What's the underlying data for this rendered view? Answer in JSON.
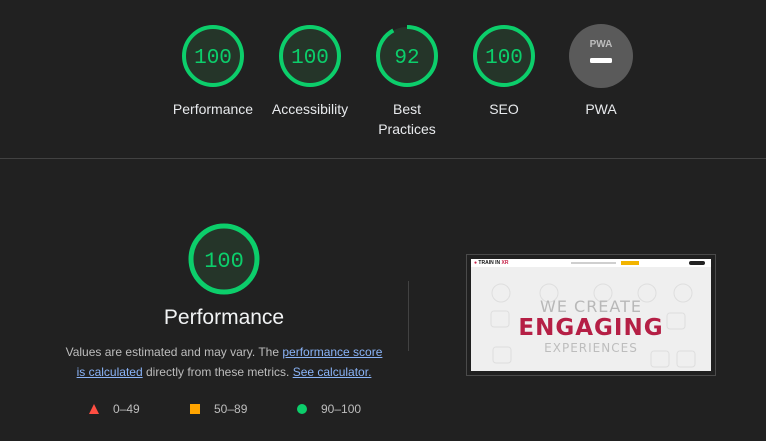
{
  "summary": {
    "categories": [
      {
        "label": "Performance",
        "score": "100",
        "value": 100
      },
      {
        "label": "Accessibility",
        "score": "100",
        "value": 100
      },
      {
        "label": "Best Practices",
        "score": "92",
        "value": 92
      },
      {
        "label": "SEO",
        "score": "100",
        "value": 100
      },
      {
        "label": "PWA",
        "score": "",
        "value": null,
        "badge_text": "PWA"
      }
    ]
  },
  "performance": {
    "score": "100",
    "value": 100,
    "title": "Performance",
    "desc_prefix": "Values are estimated and may vary. The ",
    "link1_part1": "performance score",
    "link1_part2": "is calculated",
    "desc_middle": " directly from these metrics. ",
    "link2": "See calculator."
  },
  "legend": [
    {
      "range": "0–49",
      "color": "#ff4e42",
      "shape": "triangle"
    },
    {
      "range": "50–89",
      "color": "#ffa400",
      "shape": "square"
    },
    {
      "range": "90–100",
      "color": "#0cce6b",
      "shape": "circle"
    }
  ],
  "screenshot": {
    "logo_prefix": "TRAIN IN ",
    "logo_xr": "XR",
    "line1": "WE CREATE",
    "line2": "ENGAGING",
    "line3": "EXPERIENCES"
  },
  "colors": {
    "pass": "#0cce6b",
    "pass_fill": "#253529",
    "pwa_gray": "#5a5a5a",
    "link": "#8ab4f8"
  }
}
